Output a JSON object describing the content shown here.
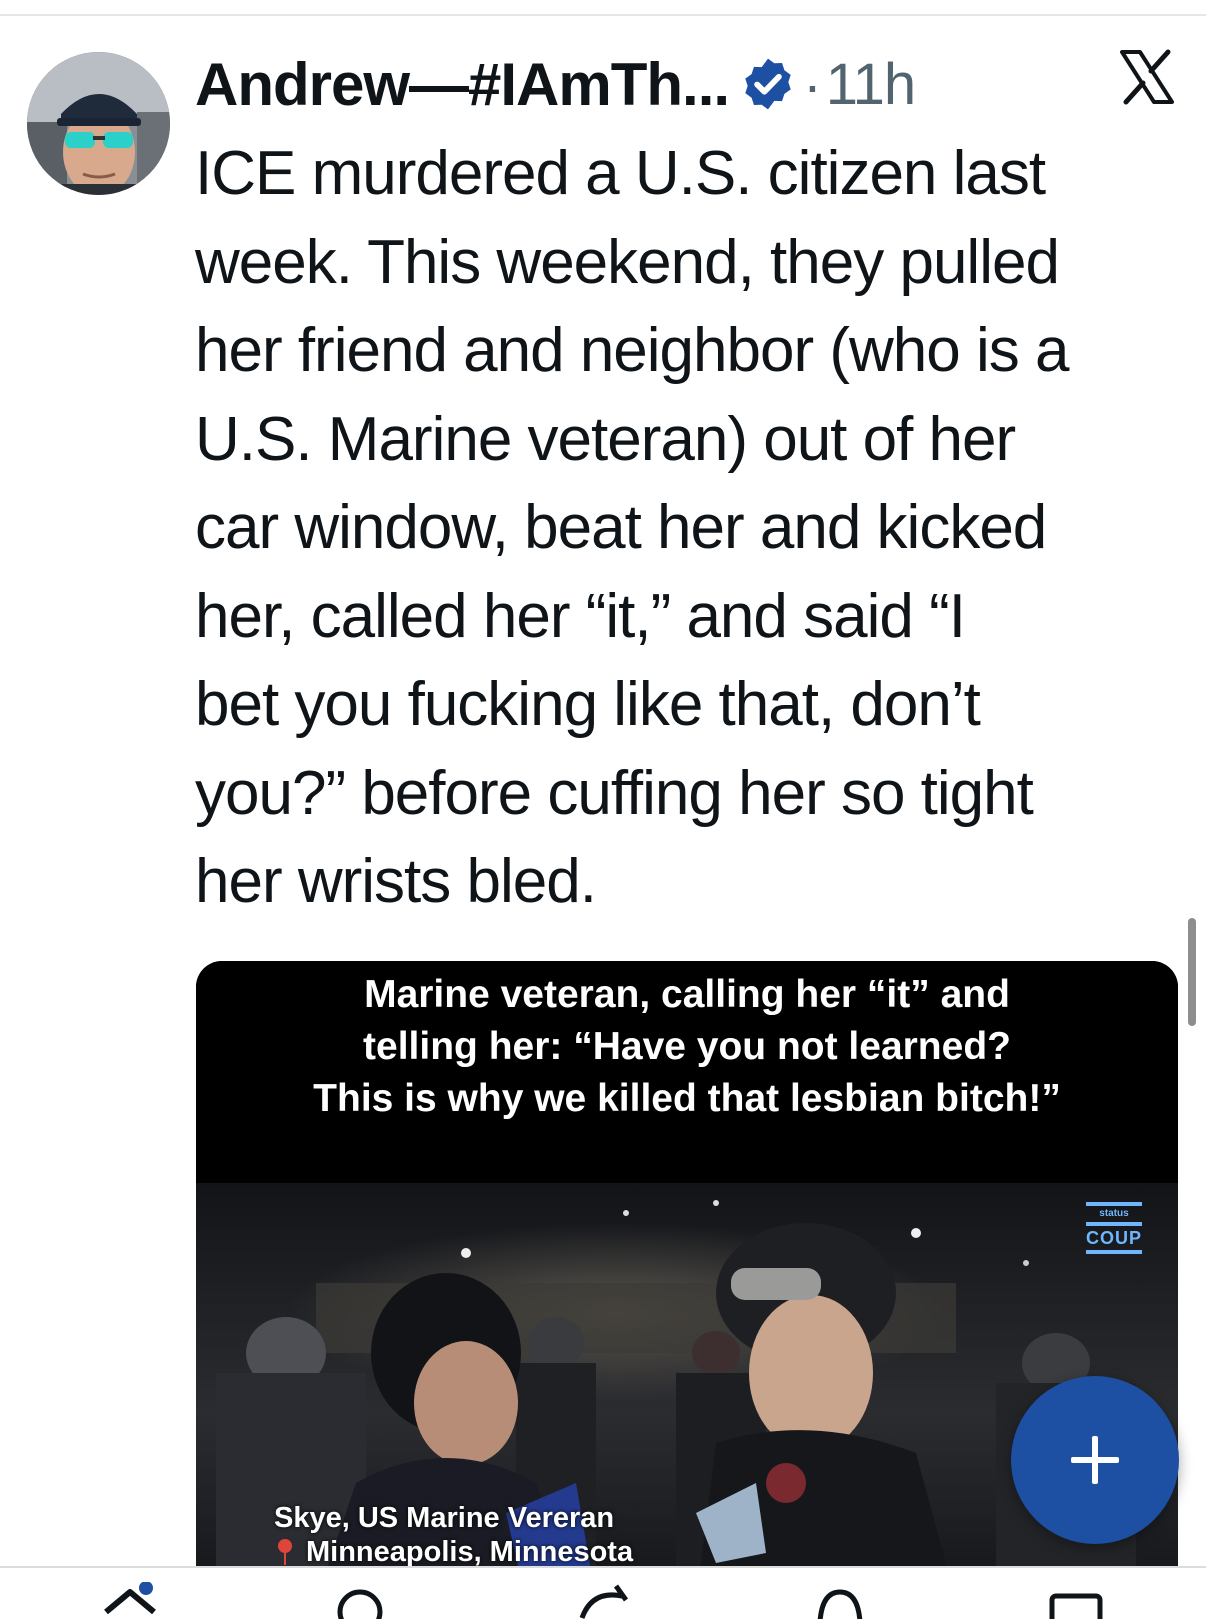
{
  "post": {
    "author_name": "Andrew—#IAmTh...",
    "separator": "·",
    "time": "11h",
    "text": "ICE murdered a U.S. citizen last\nweek. This weekend, they pulled\nher friend and neighbor (who is a\nU.S. Marine veteran) out of her\ncar window, beat her and kicked\nher, called her “it,” and said “I\nbet you fucking like that, don’t\nyou?” before cuffing her so tight\nher wrists bled.",
    "verified_icon": "verified-badge-icon",
    "close_icon": "x-logo-icon"
  },
  "media": {
    "caption_lines": [
      "Marine  veteran, calling her “it” and",
      "telling her:  “Have you not learned?",
      "This is why we killed that lesbian bitch!”"
    ],
    "watermark_small": "status",
    "watermark": "COUP",
    "lower_third_name": "Skye, US Marine Vereran",
    "lower_third_location": "Minneapolis, Minnesota"
  },
  "fab": {
    "icon": "plus-icon",
    "color": "#1d4fa3"
  },
  "bottom_nav": {
    "icons": [
      "home-icon",
      "search-icon",
      "grok-icon",
      "notifications-icon",
      "messages-icon"
    ]
  },
  "colors": {
    "text": "#0f1419",
    "muted": "#536471",
    "verified": "#1d4fa3",
    "accent": "#1d4fa3"
  }
}
